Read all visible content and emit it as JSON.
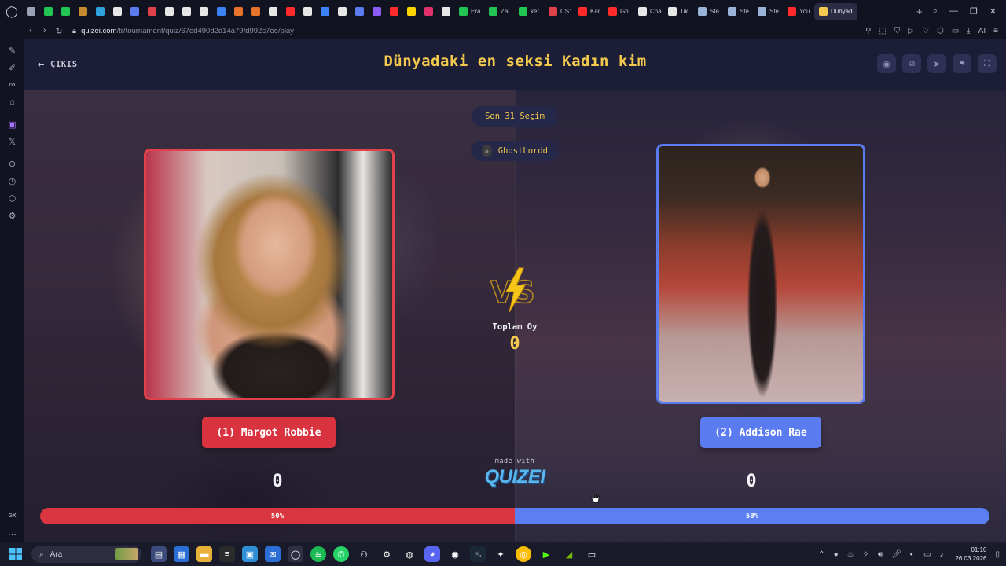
{
  "browser": {
    "tabs": [
      {
        "label": "",
        "color": "#9aa0b5"
      },
      {
        "label": "",
        "color": "#23c552"
      },
      {
        "label": "",
        "color": "#23c552"
      },
      {
        "label": "",
        "color": "#c78b2f"
      },
      {
        "label": "",
        "color": "#2fa3e0"
      },
      {
        "label": "",
        "color": "#e6e6e6"
      },
      {
        "label": "",
        "color": "#5b7bf0"
      },
      {
        "label": "",
        "color": "#e0414a"
      },
      {
        "label": "",
        "color": "#e6e6e6"
      },
      {
        "label": "",
        "color": "#e6e6e6"
      },
      {
        "label": "",
        "color": "#e6e6e6"
      },
      {
        "label": "",
        "color": "#3b82f6"
      },
      {
        "label": "",
        "color": "#e8742c"
      },
      {
        "label": "",
        "color": "#e8742c"
      },
      {
        "label": "",
        "color": "#e6e6e6"
      },
      {
        "label": "",
        "color": "#ff2a2a"
      },
      {
        "label": "",
        "color": "#e6e6e6"
      },
      {
        "label": "",
        "color": "#3b82f6"
      },
      {
        "label": "",
        "color": "#e6e6e6"
      },
      {
        "label": "",
        "color": "#5b7bf0"
      },
      {
        "label": "",
        "color": "#8b5cf6"
      },
      {
        "label": "",
        "color": "#ff2a2a"
      },
      {
        "label": "",
        "color": "#ffd400"
      },
      {
        "label": "",
        "color": "#e1306c"
      },
      {
        "label": "",
        "color": "#e6e6e6"
      },
      {
        "label": "Era",
        "color": "#23c552"
      },
      {
        "label": "Zal",
        "color": "#23c552"
      },
      {
        "label": "ker",
        "color": "#23c552"
      },
      {
        "label": "CS:",
        "color": "#e0414a"
      },
      {
        "label": "Kar",
        "color": "#ff2a2a"
      },
      {
        "label": "Gh",
        "color": "#ff2a2a"
      },
      {
        "label": "Cha",
        "color": "#e6e6e6"
      },
      {
        "label": "Tik",
        "color": "#e6e6e6"
      },
      {
        "label": "Ste",
        "color": "#9ab4d8"
      },
      {
        "label": "Ste",
        "color": "#9ab4d8"
      },
      {
        "label": "Ste",
        "color": "#9ab4d8"
      },
      {
        "label": "You",
        "color": "#ff2a2a"
      },
      {
        "label": "Dünyad",
        "color": "#f3c94e",
        "active": true
      }
    ],
    "url_host": "quizei.com",
    "url_path": "/tr/tournament/quiz/67ed490d2d14a79fd992c7ee/play",
    "ai_label": "AI"
  },
  "page": {
    "exit_label": "ÇIKIŞ",
    "title": "Dünyadaki en seksi Kadın kim",
    "round_label": "Son 31 Seçim",
    "creator_name": "GhostLordd",
    "total_label": "Toplam Oy",
    "total_votes": "0",
    "left": {
      "name": "(1) Margot Robbie",
      "votes": "0",
      "percent_label": "50%",
      "share": 0.5,
      "color": "#d9363f"
    },
    "right": {
      "name": "(2) Addison Rae",
      "votes": "0",
      "percent_label": "50%",
      "share": 0.5,
      "color": "#5b7ff3"
    },
    "made_with": "made with",
    "brand": "QUIZEI"
  },
  "sidebar": {
    "gx_label": "GX"
  },
  "taskbar": {
    "search_placeholder": "Ara",
    "time": "01:10",
    "date": "26.03.2026"
  }
}
